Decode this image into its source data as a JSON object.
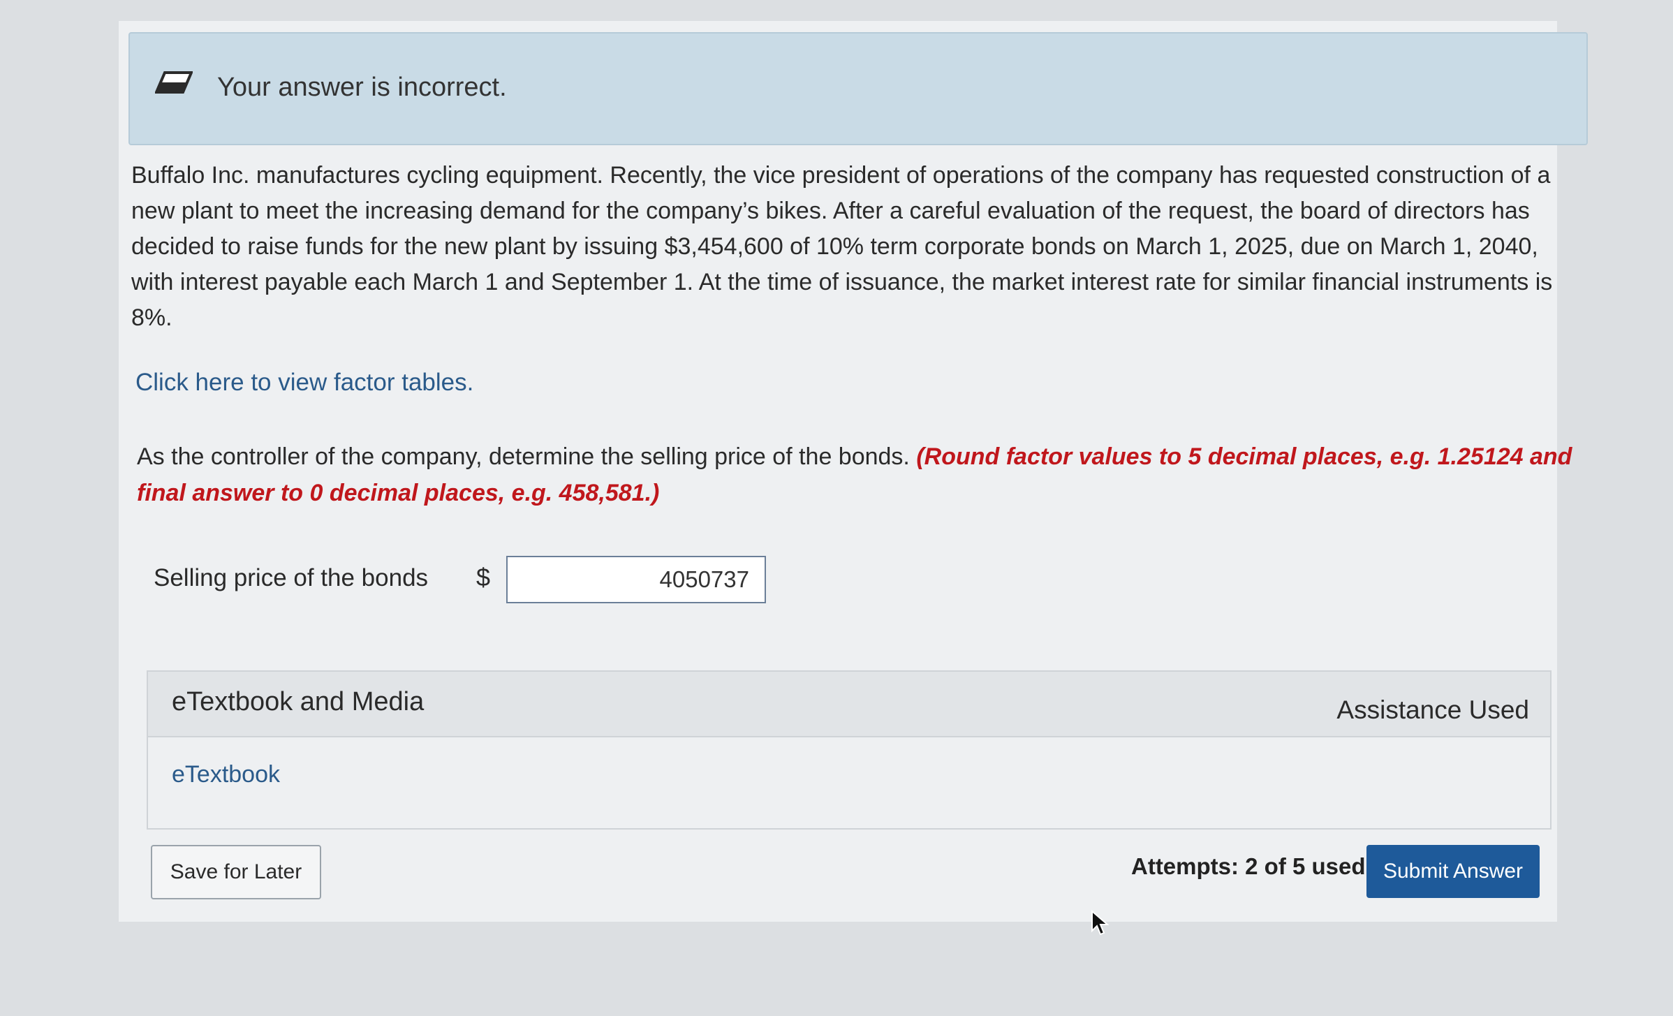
{
  "feedback": {
    "message": "Your answer is incorrect.",
    "icon": "eraser-icon"
  },
  "question": {
    "text": "Buffalo Inc. manufactures cycling equipment. Recently, the vice president of operations of the company has requested construction of a new plant to meet the increasing demand for the company’s bikes. After a careful evaluation of the request, the board of directors has decided to raise funds for the new plant by issuing $3,454,600 of 10% term corporate bonds on March 1, 2025, due on March 1, 2040, with interest payable each March 1 and September 1. At the time of issuance, the market interest rate for similar financial instruments is 8%.",
    "factor_link": "Click here to view factor tables.",
    "instruction": "As the controller of the company, determine the selling price of the bonds. ",
    "instruction_hint": "(Round factor values to 5 decimal places, e.g. 1.25124 and final answer to 0 decimal places, e.g. 458,581.)"
  },
  "answer": {
    "label": "Selling price of the bonds",
    "currency": "$",
    "value": "4050737"
  },
  "panel": {
    "title": "eTextbook and Media",
    "assistance": "Assistance Used",
    "link": "eTextbook"
  },
  "footer": {
    "save_label": "Save for Later",
    "attempts": "Attempts: 2 of 5 used",
    "submit_label": "Submit Answer"
  },
  "colors": {
    "feedback_bg": "#c9dbe6",
    "link": "#2a5a8a",
    "hint_red": "#c0171c",
    "submit_bg": "#1e5a9a"
  }
}
